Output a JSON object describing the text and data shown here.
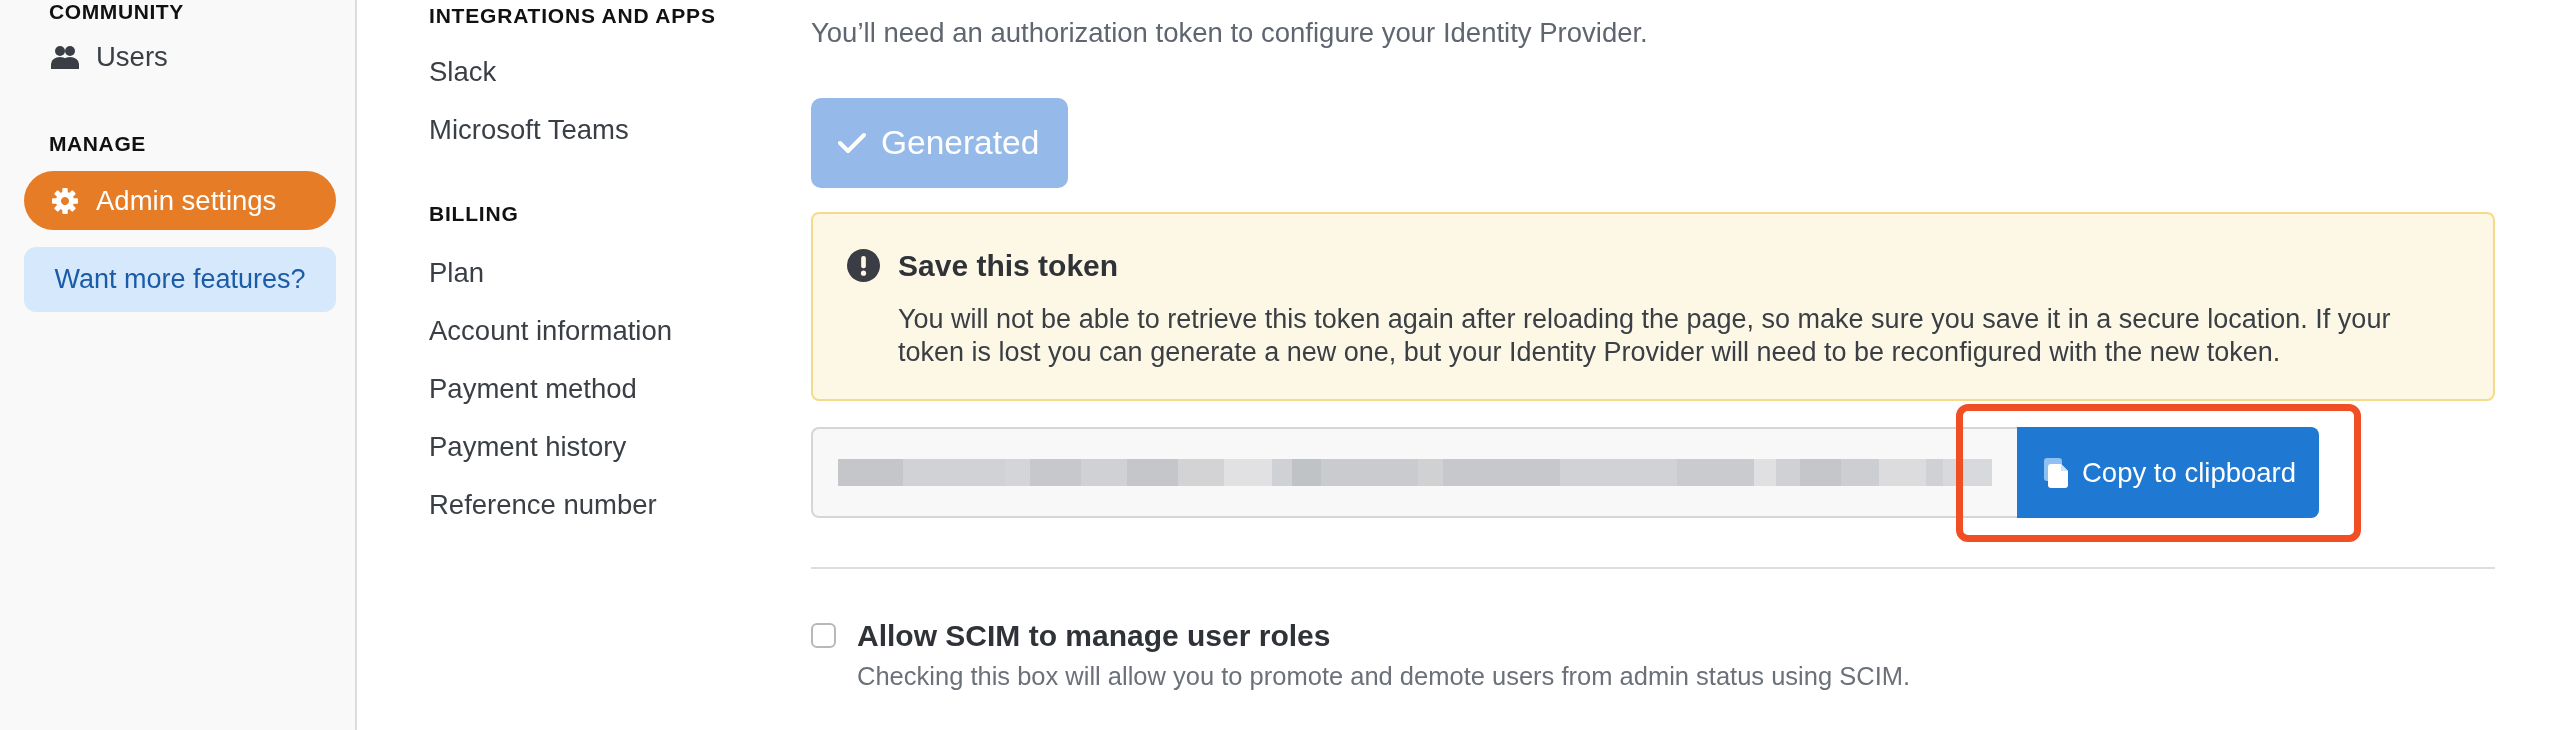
{
  "sidebar": {
    "sections": [
      {
        "heading": "COMMUNITY",
        "items": [
          {
            "label": "Users",
            "selected": false
          }
        ]
      },
      {
        "heading": "MANAGE",
        "items": [
          {
            "label": "Admin settings",
            "selected": true
          }
        ]
      }
    ],
    "upgrade_link": "Want more features?"
  },
  "settings_nav": {
    "sections": [
      {
        "heading": "INTEGRATIONS AND APPS",
        "items": [
          {
            "label": "Slack",
            "selected": false
          },
          {
            "label": "Microsoft Teams",
            "selected": false
          }
        ]
      },
      {
        "heading": "BILLING",
        "items": [
          {
            "label": "Plan",
            "selected": false
          },
          {
            "label": "Account information",
            "selected": false
          },
          {
            "label": "Payment method",
            "selected": false
          },
          {
            "label": "Payment history",
            "selected": false
          },
          {
            "label": "Reference number",
            "selected": false
          }
        ]
      }
    ]
  },
  "main": {
    "description": "You’ll need an authorization token to configure your Identity Provider.",
    "generate_button": {
      "label": "Generated",
      "disabled": true
    },
    "warning": {
      "title": "Save this token",
      "text": "You will not be able to retrieve this token again after reloading the page, so make sure you save it in a secure location. If your token is lost you can generate a new one, but your Identity Provider will need to be reconfigured with the new token."
    },
    "copy_button": {
      "label": "Copy to clipboard",
      "highlighted": true
    },
    "scim_roles_option": {
      "label": "Allow SCIM to manage user roles",
      "description": "Checking this box will allow you to promote and demote users from admin status using SCIM.",
      "checked": false
    }
  }
}
